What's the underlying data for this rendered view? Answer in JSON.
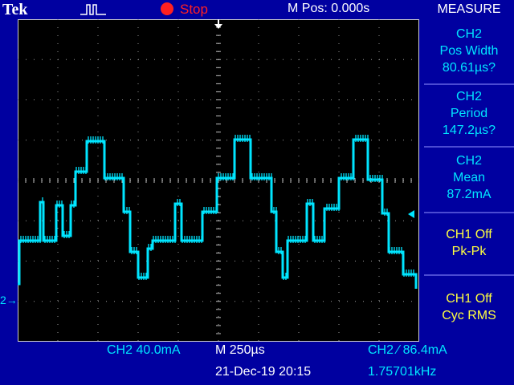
{
  "header": {
    "brand": "Tek",
    "trigger_icon": "trigger-pulse-icon",
    "run_state": "Stop",
    "run_state_color": "#ff2020",
    "m_pos": "M Pos: 0.000s",
    "menu_title": "MEASURE"
  },
  "measurements": [
    {
      "source": "CH2",
      "type": "Pos Width",
      "value": "80.61µs?"
    },
    {
      "source": "CH2",
      "type": "Period",
      "value": "147.2µs?"
    },
    {
      "source": "CH2",
      "type": "Mean",
      "value": "87.2mA"
    },
    {
      "source": "CH1 Off",
      "type": "Pk-Pk"
    },
    {
      "source": "CH1 Off",
      "type": "Cyc RMS"
    }
  ],
  "channel_marker": "2→",
  "footer": {
    "ch2_scale": "CH2  40.0mA",
    "timebase": "M 250µs",
    "trigger": "CH2 ∕ 86.4mA",
    "datetime": "21-Dec-19 20:15",
    "frequency": "1.75701kHz"
  },
  "colors": {
    "background": "#0000a0",
    "trace": "#00e5ff",
    "off_measure": "#ffff40"
  }
}
